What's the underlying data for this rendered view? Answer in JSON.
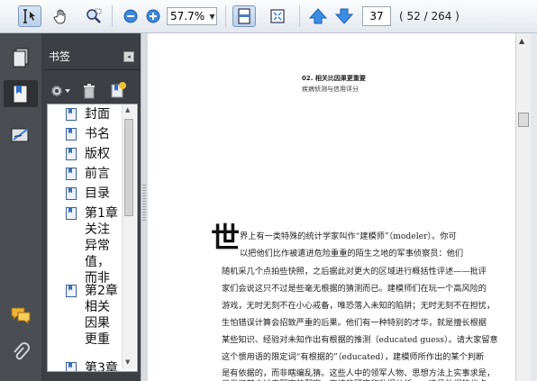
{
  "toolbar": {
    "zoom_value": "57.7%",
    "page_number": "37",
    "page_total": "( 52 / 264 )",
    "accent_color": "#2f7fd6"
  },
  "sidebar": {
    "panel_title": "书签",
    "bookmarks": [
      {
        "label": "封面"
      },
      {
        "label": "书名"
      },
      {
        "label": "版权"
      },
      {
        "label": "前言"
      },
      {
        "label": "目录"
      },
      {
        "label": "第1章关注异常值，而非"
      },
      {
        "label": "第2章相关因果更重"
      },
      {
        "label": "第3章"
      }
    ]
  },
  "document": {
    "header_title": "02. 相关比因果更重要",
    "header_subtitle": "疾病侦测与信用评分",
    "dropcap": "世",
    "lines": [
      "界上有一类特殊的统计学家叫作“建模师”（modeler）。你可",
      "以把他们比作被遣进危险重重的陌生之地的军事侦察员：他们",
      "随机采几个点拍些快照，之后据此对更大的区域进行概括性评述——批评",
      "家们会说这只不过是些毫无根据的猜测而已。建模师们在玩一个高风险的",
      "游戏，无时无刻不在小心戒备，唯恐落入未知的陷阱；无时无刻不在担忧，",
      "生怕错误计算会招致严重的后果。他们有一种特别的才华，就是擅长根据",
      "某些知识、经验对未知作出有根据的推测（educated guess）。请大家留意",
      "这个惯用语的限定词“有根据的”（educated），建模师所作出的某个判断",
      "是有依据的，而非瞎编乱猜。这些人中的领军人物、思想方法上实事求是，",
      "只尝了其中过来翻究的翻察，直接的研究和数据分析——这县他们的代点"
    ]
  }
}
